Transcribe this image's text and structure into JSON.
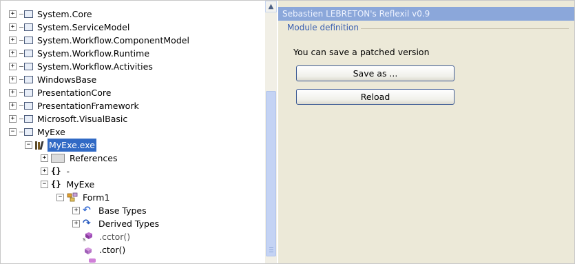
{
  "tree": {
    "top_items": [
      {
        "label": "System.Core",
        "expander": "+"
      },
      {
        "label": "System.ServiceModel",
        "expander": "+"
      },
      {
        "label": "System.Workflow.ComponentModel",
        "expander": "+"
      },
      {
        "label": "System.Workflow.Runtime",
        "expander": "+"
      },
      {
        "label": "System.Workflow.Activities",
        "expander": "+"
      },
      {
        "label": "WindowsBase",
        "expander": "+"
      },
      {
        "label": "PresentationCore",
        "expander": "+"
      },
      {
        "label": "PresentationFramework",
        "expander": "+"
      },
      {
        "label": "Microsoft.VisualBasic",
        "expander": "+"
      }
    ],
    "myexe": {
      "label": "MyExe",
      "expander": "−"
    },
    "module": {
      "label": "MyExe.exe",
      "expander": "−"
    },
    "references": {
      "label": "References",
      "expander": "+"
    },
    "ns_empty": {
      "icon": "{}",
      "label": "-",
      "expander": "+"
    },
    "ns_myexe": {
      "icon": "{}",
      "label": "MyExe",
      "expander": "−"
    },
    "form1": {
      "label": "Form1",
      "expander": "−"
    },
    "base_types": {
      "label": "Base Types",
      "expander": "+"
    },
    "derived_types": {
      "label": "Derived Types",
      "expander": "+"
    },
    "cctor": {
      "label": ".cctor()"
    },
    "ctor": {
      "label": ".ctor()"
    }
  },
  "panel": {
    "title": "Sebastien LEBRETON's Reflexil v0.9",
    "group_label": "Module definition",
    "message": "You can save a patched version",
    "save_button": "Save as ...",
    "reload_button": "Reload"
  },
  "colors": {
    "selection": "#316ac5",
    "title_bar": "#8ba7da",
    "group_label": "#3a5fb0",
    "panel_bg": "#ece9d8"
  }
}
